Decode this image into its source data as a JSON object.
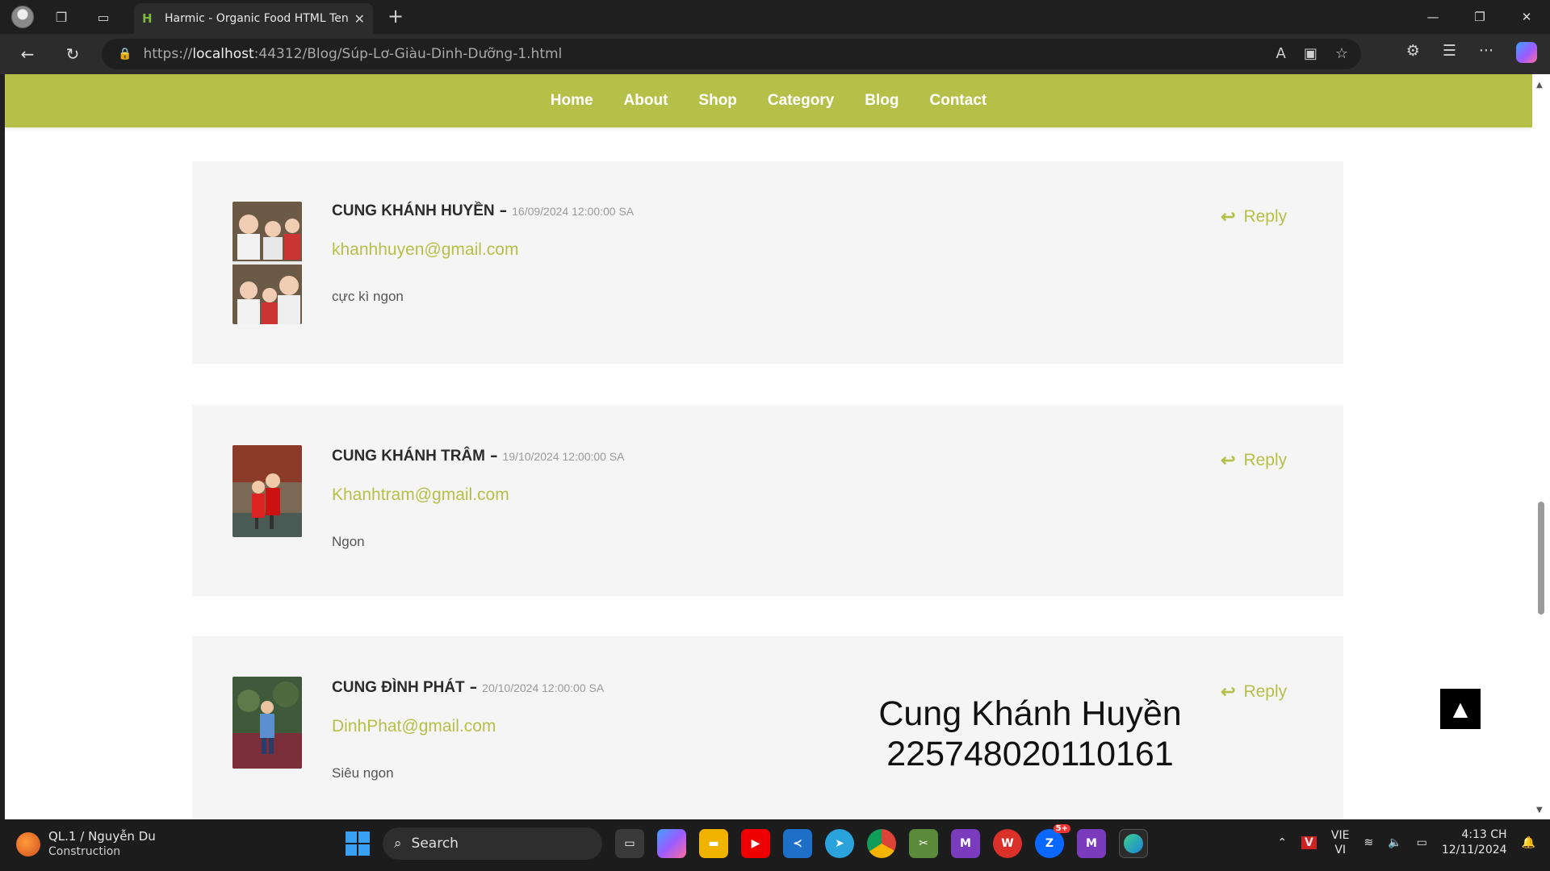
{
  "browser": {
    "tab_title": "Harmic - Organic Food HTML Ten",
    "url_prefix": "https://",
    "url_host": "localhost",
    "url_rest": ":44312/Blog/Súp-Lơ-Giàu-Dinh-Dưỡng-1.html"
  },
  "nav": {
    "items": [
      "Home",
      "About",
      "Shop",
      "Category",
      "Blog",
      "Contact"
    ]
  },
  "comments": [
    {
      "name": "CUNG KHÁNH HUYỀN",
      "date": "16/09/2024 12:00:00 SA",
      "email": "khanhhuyen@gmail.com",
      "text": "cực kì ngon",
      "reply": "Reply"
    },
    {
      "name": "CUNG KHÁNH TRÂM",
      "date": "19/10/2024 12:00:00 SA",
      "email": "Khanhtram@gmail.com",
      "text": "Ngon",
      "reply": "Reply"
    },
    {
      "name": "CUNG ĐÌNH PHÁT",
      "date": "20/10/2024 12:00:00 SA",
      "email": "DinhPhat@gmail.com",
      "text": "Siêu ngon",
      "reply": "Reply"
    }
  ],
  "overlay": {
    "line1": "Cung Khánh Huyền",
    "line2": "225748020110161"
  },
  "taskbar": {
    "weather_title": "QL.1 / Nguyễn Du",
    "weather_sub": "Construction",
    "search_label": "Search",
    "lang_top": "VIE",
    "lang_bottom": "VI",
    "time": "4:13 CH",
    "date": "12/11/2024",
    "zalo_badge": "5+"
  },
  "colors": {
    "accent": "#b6c049",
    "card_bg": "#f5f5f5"
  }
}
